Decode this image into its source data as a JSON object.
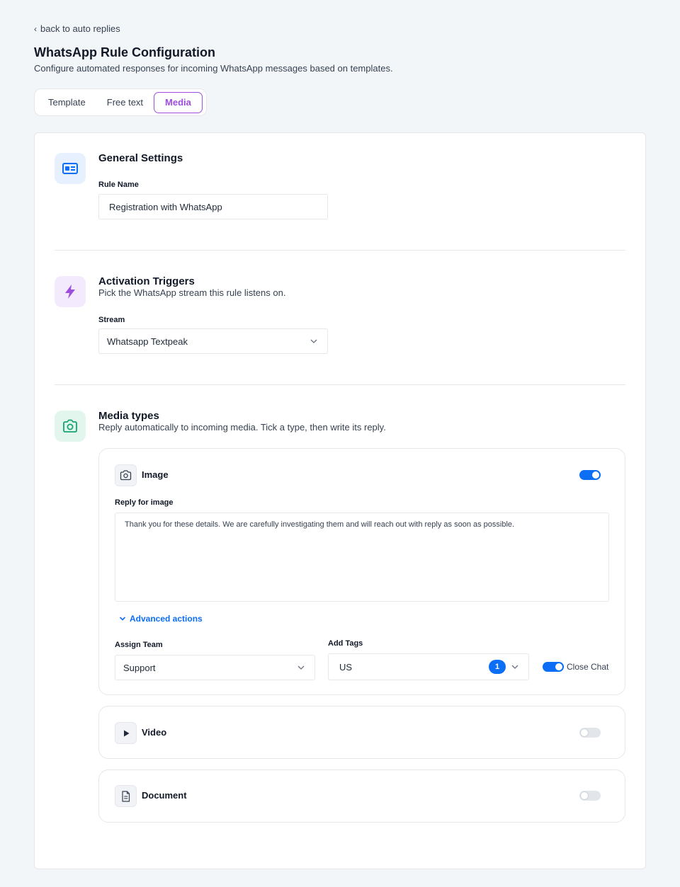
{
  "header": {
    "back_link": "back to auto replies",
    "title": "WhatsApp Rule Configuration",
    "subtitle": "Configure automated responses for incoming WhatsApp messages based on templates."
  },
  "tabs": [
    {
      "label": "Template",
      "active": false
    },
    {
      "label": "Free text",
      "active": false
    },
    {
      "label": "Media",
      "active": true
    }
  ],
  "general": {
    "title": "General Settings",
    "rule_name_label": "Rule Name",
    "rule_name_value": "Registration with WhatsApp"
  },
  "triggers": {
    "title": "Activation Triggers",
    "description": "Pick the WhatsApp stream this rule listens on.",
    "stream_label": "Stream",
    "stream_value": "Whatsapp Textpeak"
  },
  "media": {
    "title": "Media types",
    "description": "Reply automatically to incoming media. Tick a type, then write its reply.",
    "image": {
      "name": "Image",
      "enabled": true,
      "reply_label": "Reply for image",
      "reply_text": "Thank you for these details. We are carefully investigating them and will reach out with reply as soon as possible.",
      "advanced_label": "Advanced actions",
      "assign_team_label": "Assign Team",
      "assign_team_value": "Support",
      "add_tags_label": "Add Tags",
      "add_tags_value": "US",
      "tags_count": "1",
      "close_chat_label": "Close Chat",
      "close_chat_enabled": true
    },
    "video": {
      "name": "Video",
      "enabled": false
    },
    "document": {
      "name": "Document",
      "enabled": false
    }
  },
  "colors": {
    "accent_purple": "#9d4edd",
    "primary_blue": "#0b6ef5",
    "green": "#17a672"
  },
  "icons": {
    "general": "id-card-icon",
    "triggers": "lightning-icon",
    "media": "camera-icon",
    "image": "camera-icon",
    "video": "play-icon",
    "document": "document-icon"
  }
}
